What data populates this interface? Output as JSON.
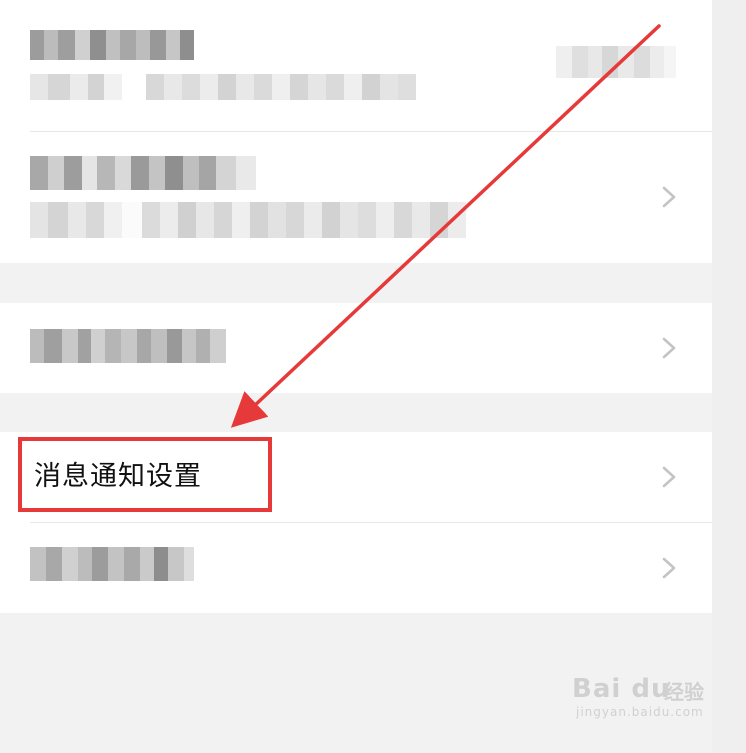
{
  "settings": {
    "notification_label": "消息通知设置"
  },
  "watermark": {
    "brand": "Bai du",
    "suffix": "经验",
    "url": "jingyan.baidu.com"
  },
  "icons": {
    "chevron": "chevron-right-icon",
    "annotation": "red-arrow-annotation"
  },
  "colors": {
    "highlight": "#e63a3a",
    "background": "#f2f2f2",
    "row": "#ffffff",
    "chevron": "#c4c4c4"
  }
}
